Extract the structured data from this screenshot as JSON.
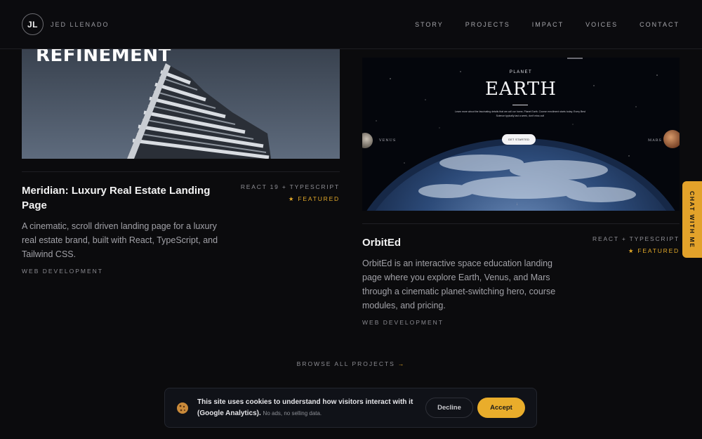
{
  "header": {
    "logo": "JL",
    "brand": "JED LLENADO",
    "nav": [
      "STORY",
      "PROJECTS",
      "IMPACT",
      "VOICES",
      "CONTACT"
    ]
  },
  "projects": [
    {
      "thumb_word": "REFINEMENT",
      "title": "Meridian: Luxury Real Estate Landing Page",
      "description": "A cinematic, scroll driven landing page for a luxury real estate brand, built with React, TypeScript, and Tailwind CSS.",
      "category": "WEB DEVELOPMENT",
      "tech": "REACT 19 + TYPESCRIPT",
      "featured": "★ FEATURED"
    },
    {
      "thumb": {
        "subtitle": "PLANET",
        "name": "EARTH",
        "blurb": "Learn more about the fascinating details that we call our home, Planet Earth. Course enrollment starts today. Every Best Science typically last a week, don't miss out!",
        "cta": "GET STARTED",
        "left_planet": "VENUS",
        "right_planet": "MARS"
      },
      "title": "OrbitEd",
      "description": "OrbitEd is an interactive space education landing page where you explore Earth, Venus, and Mars through a cinematic planet-switching hero, course modules, and pricing.",
      "category": "WEB DEVELOPMENT",
      "tech": "REACT + TYPESCRIPT",
      "featured": "★ FEATURED"
    }
  ],
  "browse": {
    "label": "BROWSE ALL PROJECTS",
    "arrow": "→"
  },
  "chat": {
    "label": "CHAT WITH ME"
  },
  "cookie": {
    "icon": "cookie-icon",
    "text": "This site uses cookies to understand how visitors interact with it (Google Analytics).",
    "note": "No ads, no selling data.",
    "decline": "Decline",
    "accept": "Accept"
  },
  "colors": {
    "accent": "#e9ad2b",
    "background": "#0b0b0d"
  }
}
